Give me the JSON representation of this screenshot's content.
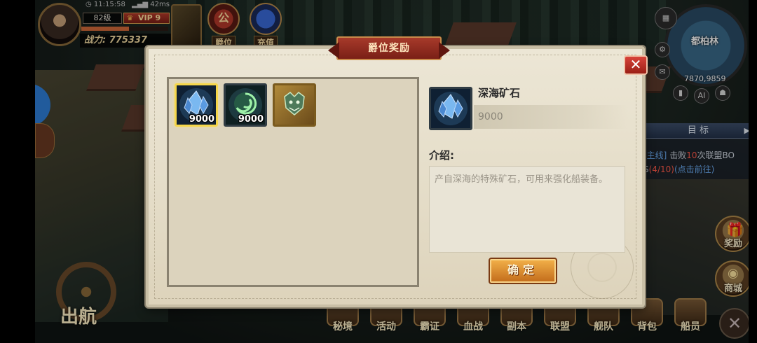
{
  "player": {
    "time": "11:15:58",
    "ping": "42ms",
    "level": "82级",
    "vip": "VIP 9",
    "power_label": "战力:",
    "power_value": "775337",
    "hp_fraction": 0.55
  },
  "top_icons": [
    {
      "id": "peerage",
      "label": "爵位",
      "badge": "公"
    },
    {
      "id": "recharge",
      "label": "充值"
    }
  ],
  "minimap": {
    "city": "都柏林",
    "coords": "7870,9859",
    "buttons": [
      "AI"
    ]
  },
  "quest": {
    "header": "目 标",
    "line1_prefix": "[主线]",
    "line1_text": " 击败",
    "line1_num": "10",
    "line1_suffix": "次联盟BO",
    "line2_prefix": "S",
    "line2_progress": "(4/10)",
    "line2_link": "(点击前往)"
  },
  "side_buttons": [
    {
      "id": "reward",
      "label": "奖励"
    },
    {
      "id": "shop",
      "label": "商城"
    }
  ],
  "bottom_bar": [
    {
      "id": "secret",
      "label": "秘境"
    },
    {
      "id": "activity",
      "label": "活动"
    },
    {
      "id": "dominate",
      "label": "霸证"
    },
    {
      "id": "bloodwar",
      "label": "血战"
    },
    {
      "id": "dungeon",
      "label": "副本"
    },
    {
      "id": "alliance",
      "label": "联盟"
    },
    {
      "id": "fleet",
      "label": "舰队"
    },
    {
      "id": "bag",
      "label": "背包"
    },
    {
      "id": "crew",
      "label": "船员"
    }
  ],
  "sail_label": "出航",
  "dialog": {
    "title": "爵位奖励",
    "rewards": [
      {
        "name": "深海矿石",
        "icon": "crystal-icon",
        "count": "9000",
        "selected": true
      },
      {
        "name": "",
        "icon": "swirl-icon",
        "count": "9000",
        "selected": false
      },
      {
        "name": "",
        "icon": "dragon-emblem-icon",
        "count": "",
        "selected": false
      }
    ],
    "detail": {
      "name": "深海矿石",
      "count": "9000",
      "intro_label": "介绍:",
      "intro_text": "产自深海的特殊矿石，可用来强化船装备。"
    },
    "confirm_label": "确定"
  }
}
